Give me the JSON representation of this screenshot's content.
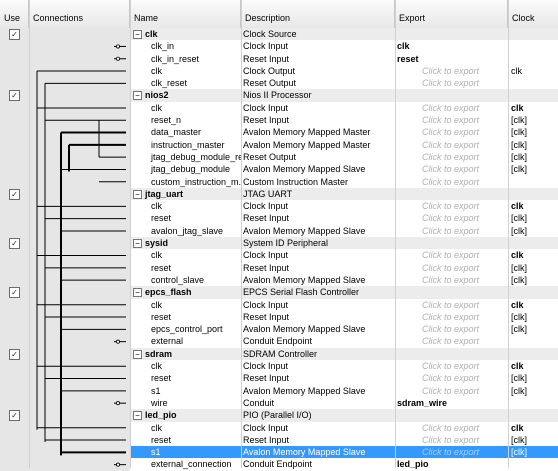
{
  "columns": {
    "use": "Use",
    "connections": "Connections",
    "name": "Name",
    "description": "Description",
    "export": "Export",
    "clock": "Clock"
  },
  "rows": [
    {
      "type": "component",
      "name": "clk",
      "description": "Clock Source",
      "export": "",
      "clock": ""
    },
    {
      "type": "port",
      "name": "clk_in",
      "description": "Clock Input",
      "export": "clk",
      "export_bold": true,
      "clock": ""
    },
    {
      "type": "port",
      "name": "clk_in_reset",
      "description": "Reset Input",
      "export": "reset",
      "export_bold": true,
      "clock": ""
    },
    {
      "type": "port",
      "name": "clk",
      "description": "Clock Output",
      "export": "Click to export",
      "clock": "clk"
    },
    {
      "type": "port",
      "name": "clk_reset",
      "description": "Reset Output",
      "export": "Click to export",
      "clock": ""
    },
    {
      "type": "component",
      "name": "nios2",
      "description": "Nios II Processor",
      "export": "",
      "clock": ""
    },
    {
      "type": "port",
      "name": "clk",
      "description": "Clock Input",
      "export": "Click to export",
      "clock": "clk",
      "clock_bold": true
    },
    {
      "type": "port",
      "name": "reset_n",
      "description": "Reset Input",
      "export": "Click to export",
      "clock": "[clk]"
    },
    {
      "type": "port",
      "name": "data_master",
      "description": "Avalon Memory Mapped Master",
      "export": "Click to export",
      "clock": "[clk]"
    },
    {
      "type": "port",
      "name": "instruction_master",
      "description": "Avalon Memory Mapped Master",
      "export": "Click to export",
      "clock": "[clk]"
    },
    {
      "type": "port",
      "name": "jtag_debug_module_re...",
      "description": "Reset Output",
      "export": "Click to export",
      "clock": "[clk]"
    },
    {
      "type": "port",
      "name": "jtag_debug_module",
      "description": "Avalon Memory Mapped Slave",
      "export": "Click to export",
      "clock": "[clk]"
    },
    {
      "type": "port",
      "name": "custom_instruction_m...",
      "description": "Custom Instruction Master",
      "export": "Click to export",
      "clock": ""
    },
    {
      "type": "component",
      "name": "jtag_uart",
      "description": "JTAG UART",
      "export": "",
      "clock": ""
    },
    {
      "type": "port",
      "name": "clk",
      "description": "Clock Input",
      "export": "Click to export",
      "clock": "clk",
      "clock_bold": true
    },
    {
      "type": "port",
      "name": "reset",
      "description": "Reset Input",
      "export": "Click to export",
      "clock": "[clk]"
    },
    {
      "type": "port",
      "name": "avalon_jtag_slave",
      "description": "Avalon Memory Mapped Slave",
      "export": "Click to export",
      "clock": "[clk]"
    },
    {
      "type": "component",
      "name": "sysid",
      "description": "System ID Peripheral",
      "export": "",
      "clock": ""
    },
    {
      "type": "port",
      "name": "clk",
      "description": "Clock Input",
      "export": "Click to export",
      "clock": "clk",
      "clock_bold": true
    },
    {
      "type": "port",
      "name": "reset",
      "description": "Reset Input",
      "export": "Click to export",
      "clock": "[clk]"
    },
    {
      "type": "port",
      "name": "control_slave",
      "description": "Avalon Memory Mapped Slave",
      "export": "Click to export",
      "clock": "[clk]"
    },
    {
      "type": "component",
      "name": "epcs_flash",
      "description": "EPCS Serial Flash Controller",
      "export": "",
      "clock": ""
    },
    {
      "type": "port",
      "name": "clk",
      "description": "Clock Input",
      "export": "Click to export",
      "clock": "clk",
      "clock_bold": true
    },
    {
      "type": "port",
      "name": "reset",
      "description": "Reset Input",
      "export": "Click to export",
      "clock": "[clk]"
    },
    {
      "type": "port",
      "name": "epcs_control_port",
      "description": "Avalon Memory Mapped Slave",
      "export": "Click to export",
      "clock": "[clk]"
    },
    {
      "type": "port",
      "name": "external",
      "description": "Conduit Endpoint",
      "export": "Click to export",
      "clock": ""
    },
    {
      "type": "component",
      "name": "sdram",
      "description": "SDRAM Controller",
      "export": "",
      "clock": ""
    },
    {
      "type": "port",
      "name": "clk",
      "description": "Clock Input",
      "export": "Click to export",
      "clock": "clk",
      "clock_bold": true
    },
    {
      "type": "port",
      "name": "reset",
      "description": "Reset Input",
      "export": "Click to export",
      "clock": "[clk]"
    },
    {
      "type": "port",
      "name": "s1",
      "description": "Avalon Memory Mapped Slave",
      "export": "Click to export",
      "clock": "[clk]"
    },
    {
      "type": "port",
      "name": "wire",
      "description": "Conduit",
      "export": "sdram_wire",
      "export_bold": true,
      "clock": ""
    },
    {
      "type": "component",
      "name": "led_pio",
      "description": "PIO (Parallel I/O)",
      "export": "",
      "clock": ""
    },
    {
      "type": "port",
      "name": "clk",
      "description": "Clock Input",
      "export": "Click to export",
      "clock": "clk",
      "clock_bold": true
    },
    {
      "type": "port",
      "name": "reset",
      "description": "Reset Input",
      "export": "Click to export",
      "clock": "[clk]"
    },
    {
      "type": "port",
      "name": "s1",
      "description": "Avalon Memory Mapped Slave",
      "export": "Click to export",
      "clock": "[clk]",
      "selected": true
    },
    {
      "type": "port",
      "name": "external_connection",
      "description": "Conduit Endpoint",
      "export": "led_pio",
      "export_bold": true,
      "clock": ""
    }
  ],
  "colors": {
    "selection": "#3399ff",
    "placeholder": "#b0b0b0",
    "connection_line": "#000000"
  },
  "icons": {
    "checkbox": "checkbox-checked-icon",
    "expander": "collapse-minus-icon"
  }
}
